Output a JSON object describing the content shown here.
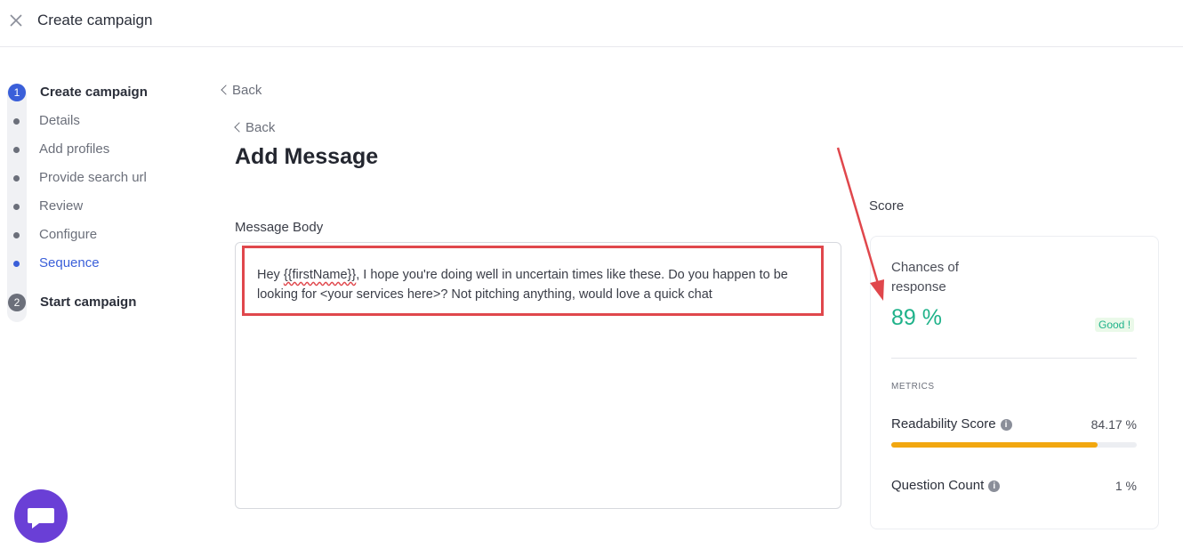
{
  "header": {
    "title": "Create campaign",
    "close_icon": "close-icon"
  },
  "stepper": {
    "step1": {
      "number": "1",
      "label": "Create campaign"
    },
    "substeps": [
      "Details",
      "Add profiles",
      "Provide search url",
      "Review",
      "Configure",
      "Sequence"
    ],
    "current_substep": "Sequence",
    "step2": {
      "number": "2",
      "label": "Start campaign"
    }
  },
  "back_outer": "Back",
  "back_inner": "Back",
  "main": {
    "title": "Add Message",
    "message_label": "Message Body",
    "message_prefix": "Hey ",
    "message_variable": "{{firstName}}",
    "message_rest": ", I hope you're doing well in uncertain times like these. Do you happen to be looking for <your services here>? Not pitching anything, would love a quick chat"
  },
  "score": {
    "label": "Score",
    "chances_label": "Chances of response",
    "percent": "89 %",
    "rating": "Good !",
    "metrics_heading": "METRICS",
    "metrics": [
      {
        "name": "Readability Score",
        "value": "84.17 %",
        "fraction": 0.8417
      },
      {
        "name": "Question Count",
        "value": "1 %"
      }
    ]
  },
  "colors": {
    "accent": "#3a5fd9",
    "good": "#1fb28a",
    "bar": "#f2a70f",
    "annotation": "#e0474c",
    "chat": "#6a3fd6"
  },
  "chat_icon": "chat-icon"
}
